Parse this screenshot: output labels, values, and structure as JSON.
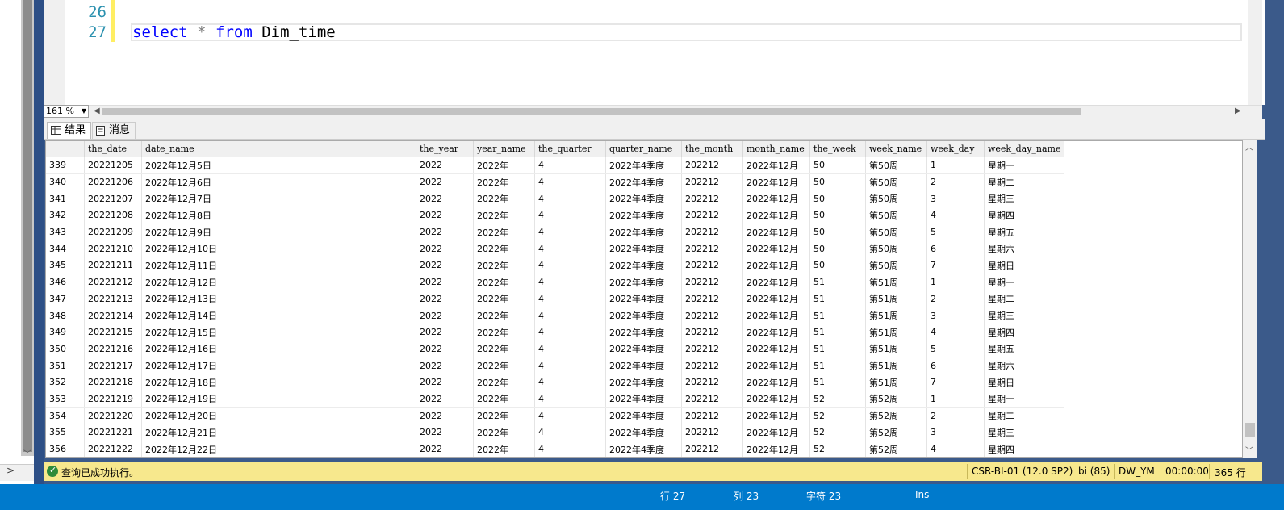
{
  "editor": {
    "lines": [
      {
        "number": "26",
        "text": ""
      },
      {
        "number": "27",
        "tokens": {
          "kw1": "select",
          "op": "*",
          "kw2": "from",
          "id": "Dim_time"
        }
      }
    ]
  },
  "zoom": {
    "value": "161 %"
  },
  "tabs": {
    "results": "结果",
    "messages": "消息"
  },
  "grid": {
    "columns": [
      "",
      "the_date",
      "date_name",
      "the_year",
      "year_name",
      "the_quarter",
      "quarter_name",
      "the_month",
      "month_name",
      "the_week",
      "week_name",
      "week_day",
      "week_day_name"
    ],
    "rows": [
      [
        "339",
        "20221205",
        "2022年12月5日",
        "2022",
        "2022年",
        "4",
        "2022年4季度",
        "202212",
        "2022年12月",
        "50",
        "第50周",
        "1",
        "星期一"
      ],
      [
        "340",
        "20221206",
        "2022年12月6日",
        "2022",
        "2022年",
        "4",
        "2022年4季度",
        "202212",
        "2022年12月",
        "50",
        "第50周",
        "2",
        "星期二"
      ],
      [
        "341",
        "20221207",
        "2022年12月7日",
        "2022",
        "2022年",
        "4",
        "2022年4季度",
        "202212",
        "2022年12月",
        "50",
        "第50周",
        "3",
        "星期三"
      ],
      [
        "342",
        "20221208",
        "2022年12月8日",
        "2022",
        "2022年",
        "4",
        "2022年4季度",
        "202212",
        "2022年12月",
        "50",
        "第50周",
        "4",
        "星期四"
      ],
      [
        "343",
        "20221209",
        "2022年12月9日",
        "2022",
        "2022年",
        "4",
        "2022年4季度",
        "202212",
        "2022年12月",
        "50",
        "第50周",
        "5",
        "星期五"
      ],
      [
        "344",
        "20221210",
        "2022年12月10日",
        "2022",
        "2022年",
        "4",
        "2022年4季度",
        "202212",
        "2022年12月",
        "50",
        "第50周",
        "6",
        "星期六"
      ],
      [
        "345",
        "20221211",
        "2022年12月11日",
        "2022",
        "2022年",
        "4",
        "2022年4季度",
        "202212",
        "2022年12月",
        "50",
        "第50周",
        "7",
        "星期日"
      ],
      [
        "346",
        "20221212",
        "2022年12月12日",
        "2022",
        "2022年",
        "4",
        "2022年4季度",
        "202212",
        "2022年12月",
        "51",
        "第51周",
        "1",
        "星期一"
      ],
      [
        "347",
        "20221213",
        "2022年12月13日",
        "2022",
        "2022年",
        "4",
        "2022年4季度",
        "202212",
        "2022年12月",
        "51",
        "第51周",
        "2",
        "星期二"
      ],
      [
        "348",
        "20221214",
        "2022年12月14日",
        "2022",
        "2022年",
        "4",
        "2022年4季度",
        "202212",
        "2022年12月",
        "51",
        "第51周",
        "3",
        "星期三"
      ],
      [
        "349",
        "20221215",
        "2022年12月15日",
        "2022",
        "2022年",
        "4",
        "2022年4季度",
        "202212",
        "2022年12月",
        "51",
        "第51周",
        "4",
        "星期四"
      ],
      [
        "350",
        "20221216",
        "2022年12月16日",
        "2022",
        "2022年",
        "4",
        "2022年4季度",
        "202212",
        "2022年12月",
        "51",
        "第51周",
        "5",
        "星期五"
      ],
      [
        "351",
        "20221217",
        "2022年12月17日",
        "2022",
        "2022年",
        "4",
        "2022年4季度",
        "202212",
        "2022年12月",
        "51",
        "第51周",
        "6",
        "星期六"
      ],
      [
        "352",
        "20221218",
        "2022年12月18日",
        "2022",
        "2022年",
        "4",
        "2022年4季度",
        "202212",
        "2022年12月",
        "51",
        "第51周",
        "7",
        "星期日"
      ],
      [
        "353",
        "20221219",
        "2022年12月19日",
        "2022",
        "2022年",
        "4",
        "2022年4季度",
        "202212",
        "2022年12月",
        "52",
        "第52周",
        "1",
        "星期一"
      ],
      [
        "354",
        "20221220",
        "2022年12月20日",
        "2022",
        "2022年",
        "4",
        "2022年4季度",
        "202212",
        "2022年12月",
        "52",
        "第52周",
        "2",
        "星期二"
      ],
      [
        "355",
        "20221221",
        "2022年12月21日",
        "2022",
        "2022年",
        "4",
        "2022年4季度",
        "202212",
        "2022年12月",
        "52",
        "第52周",
        "3",
        "星期三"
      ],
      [
        "356",
        "20221222",
        "2022年12月22日",
        "2022",
        "2022年",
        "4",
        "2022年4季度",
        "202212",
        "2022年12月",
        "52",
        "第52周",
        "4",
        "星期四"
      ]
    ]
  },
  "status": {
    "message": "查询已成功执行。",
    "server": "CSR-BI-01 (12.0 SP2)",
    "user": "bi (85)",
    "database": "DW_YM",
    "elapsed": "00:00:00",
    "row_count": "365 行"
  },
  "app_status": {
    "line": "行 27",
    "col": "列 23",
    "char": "字符 23",
    "mode": "Ins"
  },
  "colors": {
    "keyword": "#0000ff",
    "line_number": "#2b91af",
    "status_bar": "#f7e88d",
    "app_status": "#007acc"
  }
}
